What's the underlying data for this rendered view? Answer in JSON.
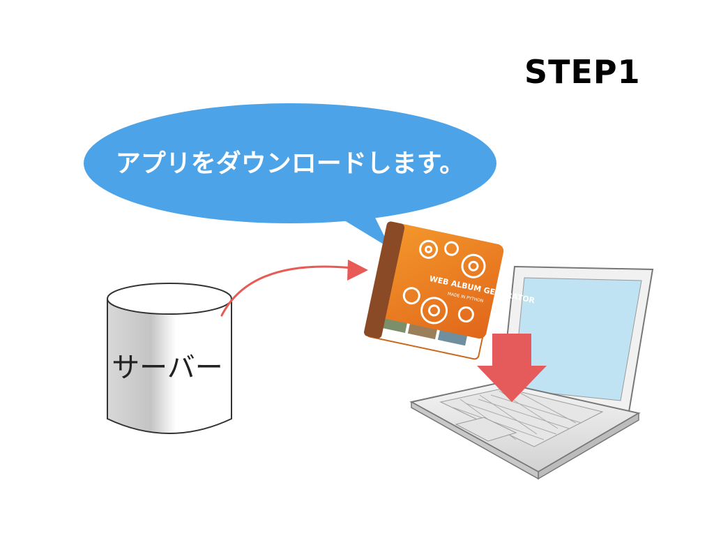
{
  "step_title": "STEP1",
  "bubble": {
    "text": "アプリをダウンロードします。"
  },
  "server": {
    "label": "サーバー"
  },
  "app_icon": {
    "title": "WEB ALBUM GENERATOR",
    "subtitle": "MADE IN PYTHON"
  },
  "colors": {
    "bubble": "#4da3e8",
    "arrow_curve": "#e85a55",
    "download_arrow": "#e55a5a",
    "book_orange": "#ef7a1a",
    "book_spine": "#8b4a26",
    "screen": "#bfe3f3"
  },
  "icons": [
    "server-cylinder-icon",
    "laptop-icon",
    "book-app-icon",
    "download-arrow-icon",
    "gear-icon"
  ]
}
